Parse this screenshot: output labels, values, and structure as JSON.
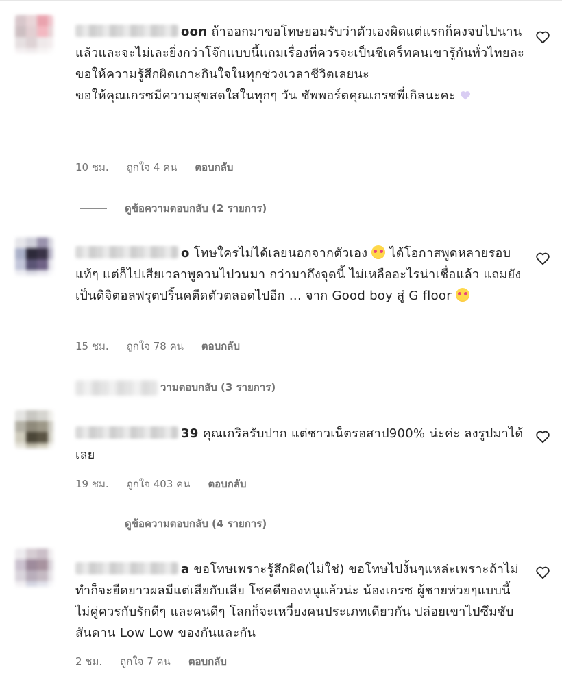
{
  "comments": [
    {
      "username_suffix": "oon",
      "text": "ถ้าออกมาขอโทษยอมรับว่าตัวเองผิดแต่แรกก็คงจบไปนานแล้วและจะไม่เละยิ่งกว่าโจ๊กแบบนี้แถมเรื่องที่ควรจะเป็นซีเคร็ทคนเขารู้กันทั่วไทยละ ขอให้ความรู้สึกผิดเกาะกินใจในทุกช่วงเวลาชีวิตเลยนะ",
      "text2": "ขอให้คุณเกรซมีความสุขสดใสในทุกๆ วัน ซัพพอร์ตคุณเกรซพี่เกิลนะคะ",
      "time": "10 ชม.",
      "likes": "ถูกใจ 4 คน",
      "reply": "ตอบกลับ",
      "view_replies": "ดูข้อความตอบกลับ (2 รายการ)"
    },
    {
      "username_suffix": "o",
      "text": "โทษใครไม่ได้เลยนอกจากตัวเอง",
      "text_b": "ได้โอกาสพูดหลายรอบแท้ๆ แต่ก็ไปเสียเวลาพูดวนไปวนมา กว่ามาถึงจุดนี้ ไม่เหลืออะไรน่าเชื่อแล้ว แถมยังเป็นดิจิตอลฟรุตปริ้นคตีดตัวตลอดไปอีก ... จาก Good boy สู่ G floor",
      "time": "15 ชม.",
      "likes": "ถูกใจ 78 คน",
      "reply": "ตอบกลับ",
      "view_replies": "วามตอบกลับ (3 รายการ)"
    },
    {
      "username_suffix": "39",
      "text": "คุณเกริลรับปาก แต่ชาวเน็ตรอสาป900% น่ะค่ะ ลงรูปมาได้เลย",
      "time": "19 ชม.",
      "likes": "ถูกใจ 403 คน",
      "reply": "ตอบกลับ",
      "view_replies": "ดูข้อความตอบกลับ (4 รายการ)"
    },
    {
      "username_suffix": "a",
      "text": "ขอโทษเพราะรู้สึกผิด(ไม่ใช่) ขอโทษไปงั้นๆแหล่ะเพราะถ้าไม่ทำก็จะยืดยาวผลมีแต่เสียกับเสีย โชคดีของหนูแล้วน่ะ น้องเกรซ ผู้ชายห่วยๆแบบนี้ ไม่คู่ควรกับรักดีๆ และคนดีๆ โลกก็จะเหวี่ยงคนประเภทเดียวกัน ปล่อยเขาไปซึมซับ สันดาน Low Low ของกันและกัน",
      "time": "2 ชม.",
      "likes": "ถูกใจ 7 คน",
      "reply": "ตอบกลับ"
    }
  ],
  "colors": {
    "text": "#262626",
    "meta": "#737373",
    "line": "#8e8e8e"
  },
  "icons": {
    "like": "heart-outline-icon"
  }
}
